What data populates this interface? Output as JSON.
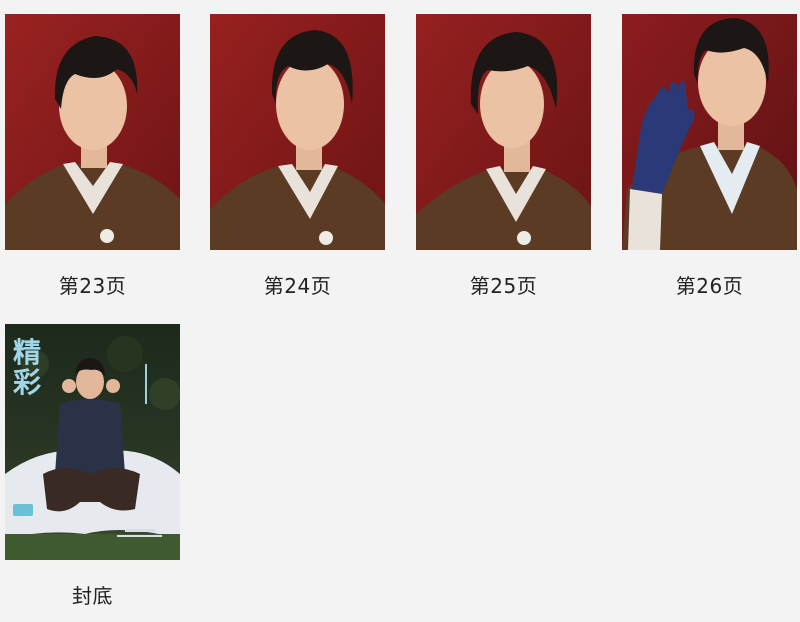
{
  "gallery": {
    "items": [
      {
        "caption": "第23页",
        "icon": "portrait-photo",
        "background": "#8a1c1c",
        "jacket": "#5a3a22"
      },
      {
        "caption": "第24页",
        "icon": "portrait-photo",
        "background": "#8a1c1c",
        "jacket": "#5a3a22"
      },
      {
        "caption": "第25页",
        "icon": "portrait-photo",
        "background": "#8a1c1c",
        "jacket": "#5a3a22"
      },
      {
        "caption": "第26页",
        "icon": "portrait-photo",
        "background": "#7a1a1c",
        "jacket": "#5a3a22"
      },
      {
        "caption": "封底",
        "icon": "magazine-cover",
        "background": "#1d2a1d",
        "jacket": "#2b3140"
      }
    ],
    "cover": {
      "title_line1": "精",
      "title_line2": "彩"
    }
  }
}
